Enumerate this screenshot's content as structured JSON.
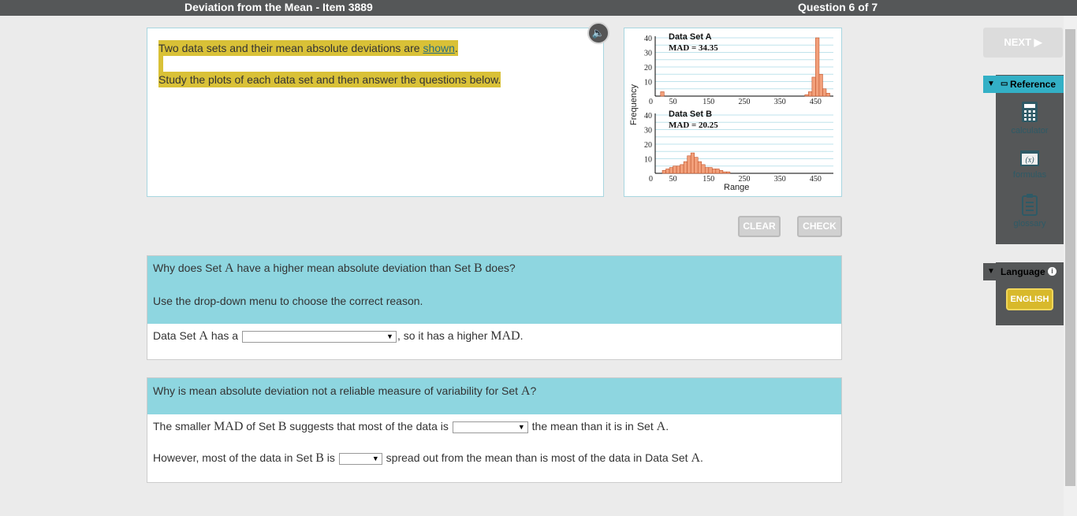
{
  "header": {
    "title": "Deviation from the Mean - Item 3889",
    "question_count": "Question 6 of 7"
  },
  "prompt": {
    "line1_pre": "Two data sets and their mean absolute deviations are ",
    "line1_link": "shown",
    "line1_post": ".",
    "line2": "Study the plots of each data set and then answer the questions below."
  },
  "buttons": {
    "clear": "CLEAR",
    "check": "CHECK",
    "next": "NEXT ▶"
  },
  "chart_data": {
    "type": "bar",
    "ylabel": "Frequency",
    "xlabel": "Range",
    "panels": [
      {
        "title": "Data Set A",
        "mad_label": "MAD = 34.35",
        "y_ticks": [
          "40",
          "30",
          "20",
          "10",
          "0"
        ],
        "x_ticks": [
          "50",
          "150",
          "250",
          "350",
          "450"
        ],
        "ylim": [
          0,
          40
        ],
        "bins": [
          {
            "x": 20,
            "y": 3
          },
          {
            "x": 425,
            "y": 1
          },
          {
            "x": 435,
            "y": 3
          },
          {
            "x": 445,
            "y": 13
          },
          {
            "x": 455,
            "y": 40
          },
          {
            "x": 465,
            "y": 15
          },
          {
            "x": 475,
            "y": 5
          },
          {
            "x": 485,
            "y": 2
          }
        ]
      },
      {
        "title": "Data Set B",
        "mad_label": "MAD = 20.25",
        "y_ticks": [
          "40",
          "30",
          "20",
          "10",
          "0"
        ],
        "x_ticks": [
          "50",
          "150",
          "250",
          "350",
          "450"
        ],
        "ylim": [
          0,
          40
        ],
        "bins": [
          {
            "x": 25,
            "y": 2
          },
          {
            "x": 35,
            "y": 3
          },
          {
            "x": 45,
            "y": 4
          },
          {
            "x": 55,
            "y": 5
          },
          {
            "x": 65,
            "y": 5
          },
          {
            "x": 75,
            "y": 6
          },
          {
            "x": 85,
            "y": 8
          },
          {
            "x": 95,
            "y": 12
          },
          {
            "x": 105,
            "y": 14
          },
          {
            "x": 115,
            "y": 11
          },
          {
            "x": 125,
            "y": 8
          },
          {
            "x": 135,
            "y": 6
          },
          {
            "x": 145,
            "y": 4
          },
          {
            "x": 155,
            "y": 4
          },
          {
            "x": 165,
            "y": 3
          },
          {
            "x": 175,
            "y": 3
          },
          {
            "x": 185,
            "y": 2
          },
          {
            "x": 195,
            "y": 1
          },
          {
            "x": 205,
            "y": 1
          }
        ]
      }
    ]
  },
  "q1": {
    "head1_a": "Why does Set ",
    "head1_var": "A",
    "head1_b": " have a higher mean absolute deviation than Set ",
    "head1_var2": "B",
    "head1_c": " does?",
    "head2": "Use the drop-down menu to choose the correct reason.",
    "ans_a": "Data Set ",
    "ans_var": "A",
    "ans_b": " has a ",
    "ans_c": ", so it has a higher ",
    "ans_mad": "MAD",
    "ans_d": ".",
    "dropdown_value": ""
  },
  "q2": {
    "head_a": "Why is mean absolute deviation not a reliable measure of variability for Set ",
    "head_var": "A",
    "head_b": "?",
    "l1_a": "The smaller ",
    "l1_mad": "MAD",
    "l1_b": " of Set ",
    "l1_var": "B",
    "l1_c": " suggests that most of the data is ",
    "l1_d": " the mean than it is in Set ",
    "l1_var2": "A",
    "l1_e": ".",
    "l2_a": "However, most of the data in Set ",
    "l2_var": "B",
    "l2_b": " is ",
    "l2_c": " spread out from the mean than is most of the data in Data Set ",
    "l2_var2": "A",
    "l2_d": ".",
    "dropdown1_value": "",
    "dropdown2_value": ""
  },
  "sidebar": {
    "reference_label": "Reference",
    "tools": [
      {
        "label": "calculator",
        "icon": "calculator-icon"
      },
      {
        "label": "formulas",
        "icon": "formulas-icon"
      },
      {
        "label": "glossary",
        "icon": "glossary-icon"
      }
    ],
    "language_label": "Language",
    "language_value": "ENGLISH"
  },
  "colors": {
    "accent": "#33b0c6",
    "question_bg": "#8ed6e0",
    "highlight": "#d9c137",
    "bar_fill": "#f2a07b",
    "bar_stroke": "#c0532a"
  }
}
